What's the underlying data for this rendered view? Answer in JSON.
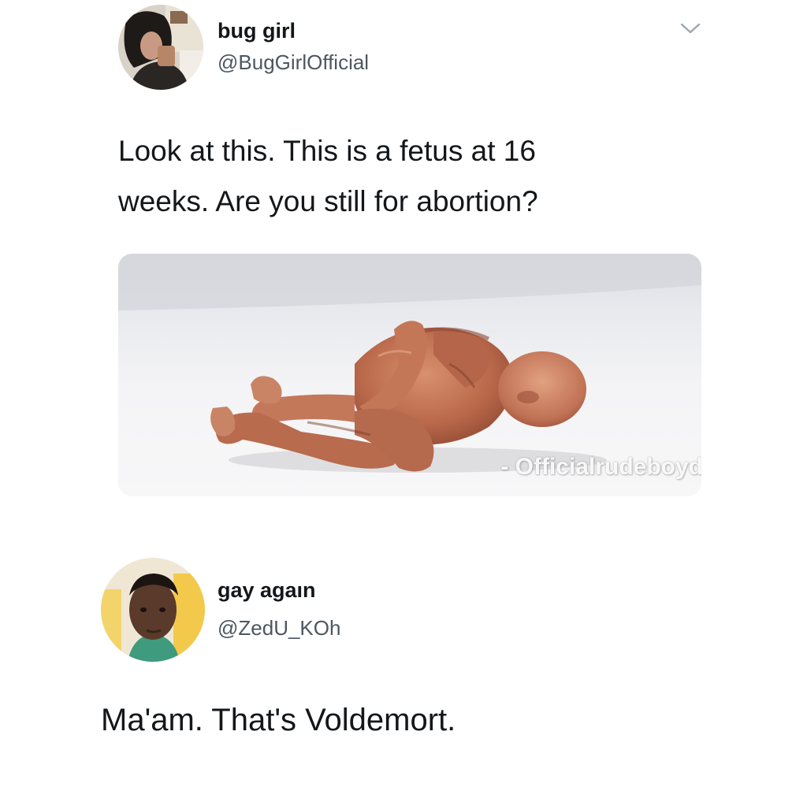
{
  "tweet": {
    "author": {
      "display_name": "bug girl",
      "handle": "@BugGirlOfficial",
      "avatar_icon": "user-avatar-photo"
    },
    "menu_icon": "chevron-down-icon",
    "text_line_1": "Look at this. This is a fetus at 16",
    "text_line_2": "weeks. Are you still for abortion?",
    "media": {
      "watermark": "- Officialrudeboyd"
    }
  },
  "reply": {
    "author": {
      "display_name": "gay agaın",
      "handle": "@ZedU_KOh",
      "avatar_icon": "user-avatar-photo"
    },
    "text": "Ma'am. That's Voldemort."
  }
}
